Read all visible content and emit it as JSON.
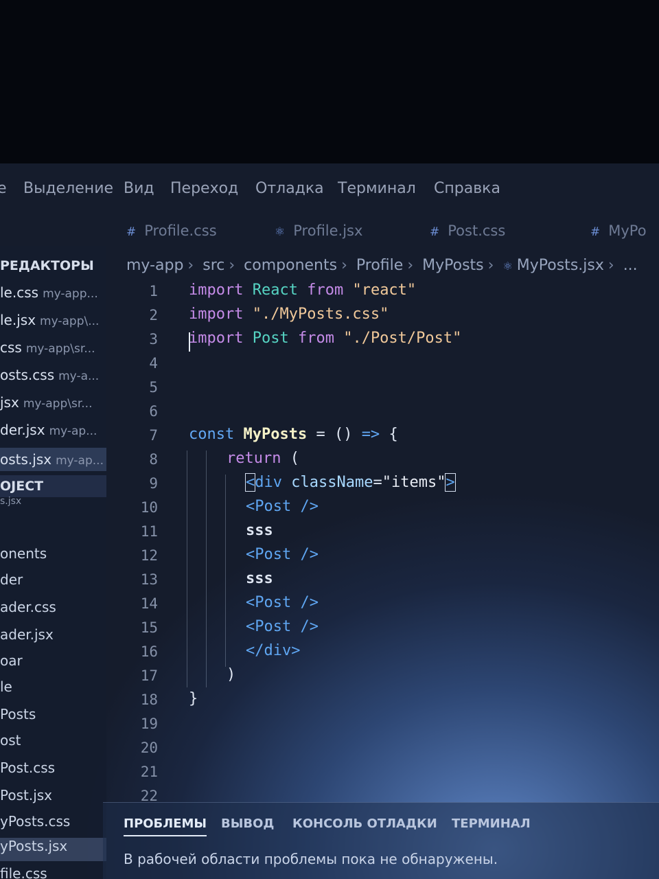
{
  "menu": {
    "items": [
      "е",
      "Выделение",
      "Вид",
      "Переход",
      "Отладка",
      "Терминал",
      "Справка"
    ]
  },
  "tabs": [
    {
      "label": "Profile.css",
      "icon": "hash-icon"
    },
    {
      "label": "Profile.jsx",
      "icon": "react-icon"
    },
    {
      "label": "Post.css",
      "icon": "hash-icon"
    },
    {
      "label": "MyPo",
      "icon": "hash-icon"
    }
  ],
  "sidebar": {
    "open_editors_header": "РЕДАКТОРЫ",
    "open_editors": [
      {
        "name": "le.css",
        "path": "my-app..."
      },
      {
        "name": "le.jsx",
        "path": "my-app\\..."
      },
      {
        "name": "css",
        "path": "my-app\\sr..."
      },
      {
        "name": "osts.css",
        "path": "my-a..."
      },
      {
        "name": "jsx",
        "path": "my-app\\sr..."
      },
      {
        "name": "der.jsx",
        "path": "my-ap..."
      },
      {
        "name": "osts.jsx",
        "path": "my-ap..."
      }
    ],
    "project_header": "OJECT",
    "tree": [
      "s.jsx",
      "onents",
      "der",
      "ader.css",
      "ader.jsx",
      "oar",
      "le",
      "Posts",
      "ost",
      "Post.css",
      "Post.jsx",
      "yPosts.css",
      "yPosts.jsx",
      "file.css"
    ]
  },
  "breadcrumb": [
    "my-app",
    "src",
    "components",
    "Profile",
    "MyPosts",
    "MyPosts.jsx",
    "..."
  ],
  "editor": {
    "line_numbers": [
      "1",
      "2",
      "3",
      "4",
      "5",
      "6",
      "7",
      "8",
      "9",
      "10",
      "11",
      "12",
      "13",
      "14",
      "15",
      "16",
      "17",
      "18",
      "19",
      "20",
      "21",
      "22"
    ],
    "lines": {
      "l1": {
        "kw": "import",
        "name": "React",
        "from": "from",
        "str": "\"react\""
      },
      "l2": {
        "kw": "import",
        "str": "\"./MyPosts.css\""
      },
      "l3": {
        "kw": "import",
        "name": "Post",
        "from": "from",
        "str": "\"./Post/Post\""
      },
      "l7": {
        "kw": "const",
        "name": "MyPosts",
        "rest": "= () ",
        "arrow": "=>",
        "brace": "{"
      },
      "l8": {
        "kw": "return",
        "paren": "("
      },
      "l9": {
        "open": "<",
        "tag": "div",
        "attr": "className",
        "eq": "=",
        "str": "\"items\"",
        "close": ">"
      },
      "l10": "<Post />",
      "l11": "sss",
      "l12": "<Post />",
      "l13": "sss",
      "l14": "<Post />",
      "l15": "<Post />",
      "l16": "</div>",
      "l17": ")",
      "l18": "}"
    }
  },
  "panel": {
    "tabs": [
      "ПРОБЛЕМЫ",
      "ВЫВОД",
      "КОНСОЛЬ ОТЛАДКИ",
      "ТЕРМИНАЛ"
    ],
    "message": "В рабочей области проблемы пока не обнаружены."
  }
}
